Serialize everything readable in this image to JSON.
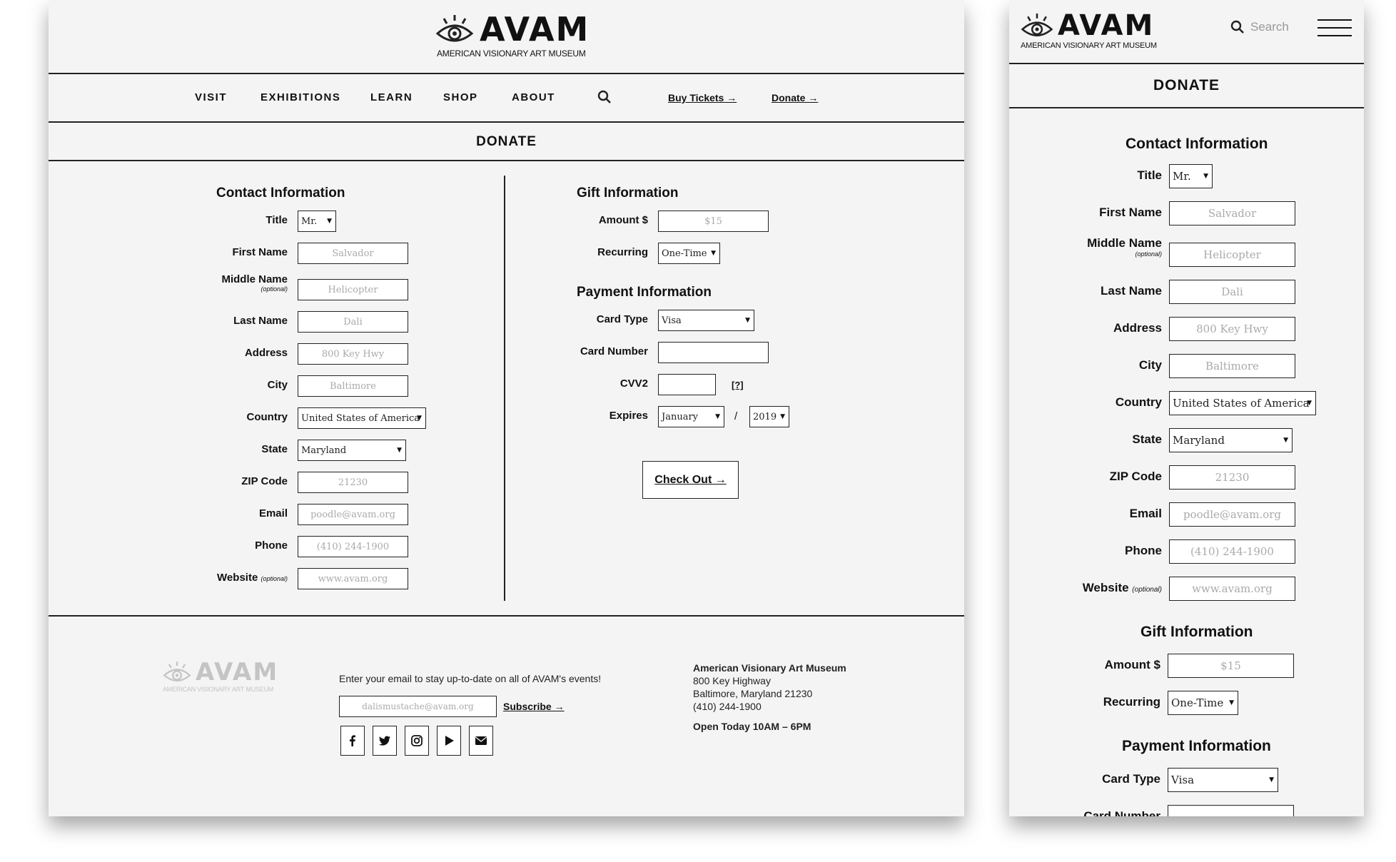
{
  "logo": {
    "word": "AVAM",
    "sub": "AMERICAN VISIONARY ART MUSEUM"
  },
  "nav": {
    "items": [
      "VISIT",
      "EXHIBITIONS",
      "LEARN",
      "SHOP",
      "ABOUT"
    ],
    "buy_tickets": "Buy Tickets →",
    "donate": "Donate →"
  },
  "page_title": "DONATE",
  "contact": {
    "title": "Contact Information",
    "fields": {
      "title": {
        "label": "Title",
        "value": "Mr."
      },
      "first_name": {
        "label": "First Name",
        "placeholder": "Salvador"
      },
      "middle_name": {
        "label": "Middle Name",
        "note": "(optional)",
        "placeholder": "Helicopter"
      },
      "last_name": {
        "label": "Last Name",
        "placeholder": "Dali"
      },
      "address": {
        "label": "Address",
        "placeholder": "800 Key Hwy"
      },
      "city": {
        "label": "City",
        "placeholder": "Baltimore"
      },
      "country": {
        "label": "Country",
        "value": "United States of America"
      },
      "state": {
        "label": "State",
        "value": "Maryland"
      },
      "zip": {
        "label": "ZIP Code",
        "placeholder": "21230"
      },
      "email": {
        "label": "Email",
        "placeholder": "poodle@avam.org"
      },
      "phone": {
        "label": "Phone",
        "placeholder": "(410) 244-1900"
      },
      "website": {
        "label": "Website",
        "note": "(optional)",
        "placeholder": "www.avam.org"
      }
    }
  },
  "gift": {
    "title": "Gift Information",
    "amount": {
      "label": "Amount $",
      "placeholder": "$15"
    },
    "recurring": {
      "label": "Recurring",
      "value": "One-Time"
    }
  },
  "payment": {
    "title": "Payment Information",
    "card_type": {
      "label": "Card Type",
      "value": "Visa"
    },
    "card_number": {
      "label": "Card Number"
    },
    "cvv": {
      "label": "CVV2",
      "help": "[?]"
    },
    "expires": {
      "label": "Expires",
      "month": "January",
      "separator": "/",
      "year": "2019"
    }
  },
  "checkout": "Check Out →",
  "footer": {
    "newsletter_text": "Enter your email to stay up-to-date on all of AVAM's events!",
    "email_placeholder": "dalismustache@avam.org",
    "subscribe": "Subscribe →",
    "social_icons": [
      "facebook-icon",
      "twitter-icon",
      "instagram-icon",
      "youtube-icon",
      "mail-icon"
    ],
    "museum_name": "American Visionary Art Museum",
    "address1": "800 Key Highway",
    "address2": "Baltimore, Maryland 21230",
    "phone": "(410) 244-1900",
    "hours": "Open Today 10AM – 6PM"
  },
  "mobile": {
    "search_placeholder": "Search"
  },
  "colors": {
    "page_bg": "#f4f4f4",
    "ink": "#222222",
    "placeholder": "#aaaaaa",
    "footer_logo": "#c4c4c4"
  }
}
